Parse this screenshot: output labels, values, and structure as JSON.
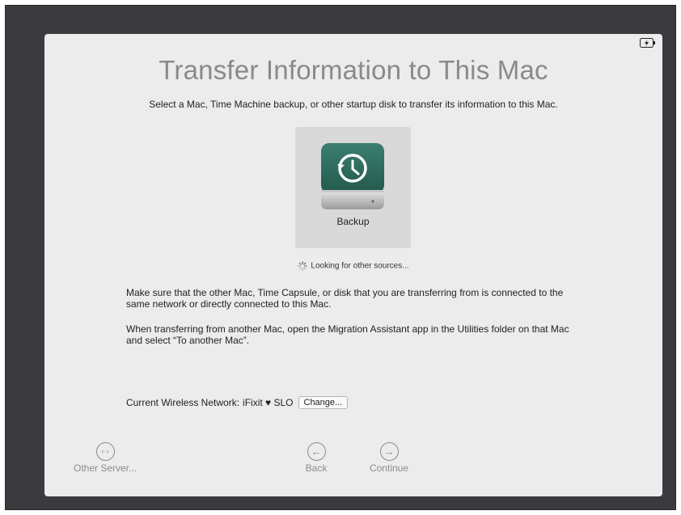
{
  "title": "Transfer Information to This Mac",
  "subtitle": "Select a Mac, Time Machine backup, or other startup disk to transfer its information to this Mac.",
  "source_tile": {
    "label": "Backup",
    "icon": "time-machine-disk-icon"
  },
  "status": {
    "text": "Looking for other sources...",
    "icon": "spinner-icon"
  },
  "paragraphs": {
    "p1": "Make sure that the other Mac, Time Capsule, or disk that you are transferring from is connected to the same network or directly connected to this Mac.",
    "p2": "When transferring from another Mac, open the Migration Assistant app in the Utilities folder on that Mac and select “To another Mac”."
  },
  "network": {
    "label": "Current Wireless Network:",
    "name": "iFixit ♥ SLO",
    "change_label": "Change..."
  },
  "nav": {
    "other_server": "Other Server...",
    "other_server_glyph": "‹·›",
    "back": "Back",
    "back_glyph": "←",
    "continue": "Continue",
    "continue_glyph": "→"
  },
  "colors": {
    "bezel": "#3a3a3f",
    "window": "#ececec",
    "tile": "#d9d9d9",
    "disk_green": "#2e6b5e"
  }
}
